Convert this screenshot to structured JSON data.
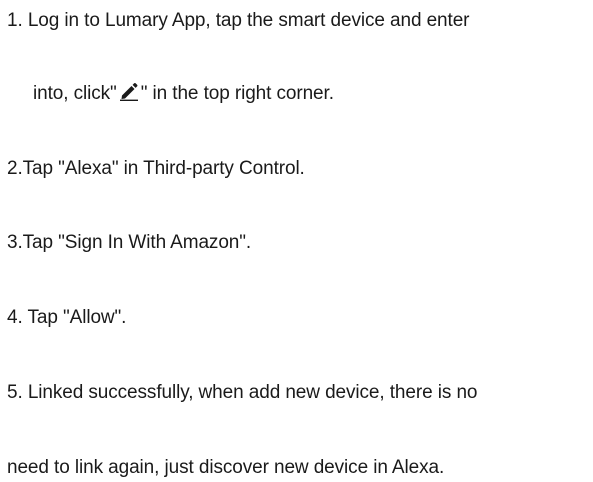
{
  "steps": [
    {
      "line1": "1. Log in to Lumary App, tap the smart device and enter",
      "line2_prefix": "into, click\"",
      "icon": "pencil-edit-icon",
      "line2_suffix": "\" in the top right corner."
    },
    {
      "text": "2.Tap \"Alexa\" in Third-party Control."
    },
    {
      "text": "3.Tap \"Sign In With Amazon\"."
    },
    {
      "text": "4. Tap \"Allow\"."
    },
    {
      "line1": "5. Linked successfully, when add new device, there is no",
      "line2": "need to link again, just discover new device in Alexa."
    }
  ],
  "colors": {
    "text": "#1a1a1a",
    "background": "#ffffff"
  }
}
